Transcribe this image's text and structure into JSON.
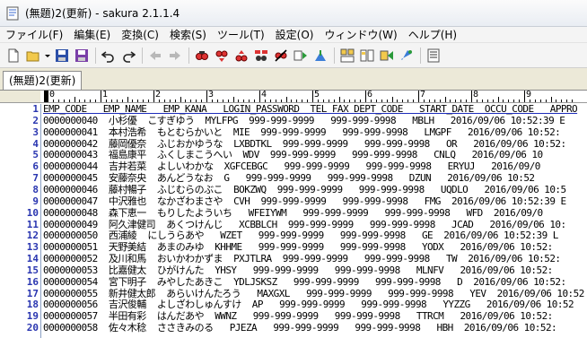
{
  "window": {
    "title": "(無題)2(更新) - sakura 2.1.1.4"
  },
  "menu": [
    "ファイル(F)",
    "編集(E)",
    "変換(C)",
    "検索(S)",
    "ツール(T)",
    "設定(O)",
    "ウィンドウ(W)",
    "ヘルプ(H)"
  ],
  "tab": {
    "label": "(無題)2(更新)"
  },
  "ruler": {
    "marks": [
      "0",
      "1",
      "2",
      "3",
      "4",
      "5",
      "6",
      "7",
      "8",
      "9"
    ]
  },
  "lines": [
    {
      "n": "1",
      "t": "EMP_CODE   EMP_NAME   EMP_KANA   LOGIN_PASSWORD  TEL FAX DEPT_CODE   START_DATE  OCCU_CODE   APPRO"
    },
    {
      "n": "2",
      "t": "0000000040  小杉優  こすぎゆう  MYLFPG  999-999-9999   999-999-9998   MBLH   2016/09/06 10:52:39 E"
    },
    {
      "n": "3",
      "t": "0000000041  本村浩希  もとむらかいと  MIE  999-999-9999   999-999-9998   LMGPF   2016/09/06 10:52:"
    },
    {
      "n": "4",
      "t": "0000000042  藤岡優奈  ふじおかゆうな  LXBDTKL  999-999-9999   999-999-9998   OR   2016/09/06 10:52:"
    },
    {
      "n": "5",
      "t": "0000000043  福島康平  ふくしまこうへい  WDV  999-999-9999   999-999-9998   CNLQ   2016/09/06 10"
    },
    {
      "n": "6",
      "t": "0000000044  吉井若菜  よしいわかな  XGFCEBGC   999-999-9999   999-999-9998   ERYUJ   2016/09/0"
    },
    {
      "n": "7",
      "t": "0000000045  安藤奈央  あんどうなお  G   999-999-9999   999-999-9998   DZUN   2016/09/06 10:52"
    },
    {
      "n": "8",
      "t": "0000000046  藤村暢子  ふじむらのぶこ  BOKZWQ  999-999-9999   999-999-9998   UQDLO   2016/09/06 10:5"
    },
    {
      "n": "9",
      "t": "0000000047  中沢雅也  なかざわまさや  CVH  999-999-9999   999-999-9998   FMG  2016/09/06 10:52:39 E"
    },
    {
      "n": "10",
      "t": "0000000048  森下恵一  もりしたよういち   WFEIYWM   999-999-9999   999-999-9998   WFD  2016/09/0"
    },
    {
      "n": "11",
      "t": "0000000049  阿久津健司  あくつけんじ   XCBBLCH  999-999-9999   999-999-9998   JCAD   2016/09/06 10:"
    },
    {
      "n": "12",
      "t": "0000000050  西浦綾  にしうらあや   WZET   999-999-9999   999-999-9998   GE  2016/09/06 10:52:39 L"
    },
    {
      "n": "13",
      "t": "0000000051  天野美結  あまのみゆ  KHHME   999-999-9999   999-999-9998   YODX   2016/09/06 10:52:"
    },
    {
      "n": "14",
      "t": "0000000052  及川和馬  おいかわかずま  PXJTLRA  999-999-9999   999-999-9998   TW  2016/09/06 10:52:"
    },
    {
      "n": "15",
      "t": "0000000053  比嘉健太  ひがけんた  YHSY   999-999-9999   999-999-9998   MLNFV   2016/09/06 10:52:"
    },
    {
      "n": "16",
      "t": "0000000054  宮下明子  みやしたあきこ  YDLJSKSZ   999-999-9999   999-999-9998   D  2016/09/06 10:52:"
    },
    {
      "n": "17",
      "t": "0000000055  新井健太郎  あらいけんたろう   MAXGXL   999-999-9999   999-999-9998   YEV  2016/09/06 10:52"
    },
    {
      "n": "18",
      "t": "0000000056  吉沢俊輔  よしざわしゅんすけ  AP   999-999-9999   999-999-9998   YYZZG   2016/09/06 10:52"
    },
    {
      "n": "19",
      "t": "0000000057  半田有彩  はんだあや  WWNZ   999-999-9999   999-999-9998   TTRCM   2016/09/06 10:52:"
    },
    {
      "n": "20",
      "t": "0000000058  佐々木稔  ささきみのる   PJEZA   999-999-9999   999-999-9998   HBH  2016/09/06 10:52:"
    }
  ]
}
